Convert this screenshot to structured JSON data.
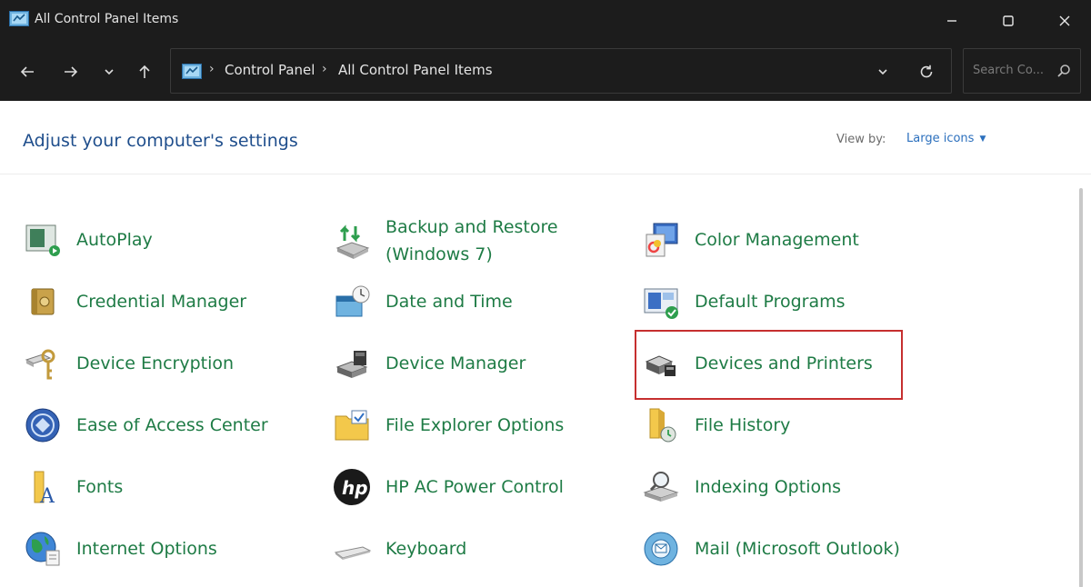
{
  "window": {
    "title": "All Control Panel Items",
    "controls": [
      "minimize",
      "maximize",
      "close"
    ]
  },
  "address": {
    "crumbs": [
      "Control Panel",
      "All Control Panel Items"
    ],
    "search_placeholder": "Search Co..."
  },
  "header": {
    "heading": "Adjust your computer's settings",
    "view_by_label": "View by:",
    "view_by_value": "Large icons"
  },
  "items": [
    {
      "label": "AutoPlay",
      "icon": "autoplay-icon"
    },
    {
      "label": "Backup and Restore (Windows 7)",
      "line1": "Backup and Restore",
      "line2": "(Windows 7)",
      "icon": "backup-restore-icon"
    },
    {
      "label": "Color Management",
      "icon": "color-management-icon"
    },
    {
      "label": "Credential Manager",
      "icon": "credential-manager-icon"
    },
    {
      "label": "Date and Time",
      "icon": "date-time-icon"
    },
    {
      "label": "Default Programs",
      "icon": "default-programs-icon"
    },
    {
      "label": "Device Encryption",
      "icon": "device-encryption-icon"
    },
    {
      "label": "Device Manager",
      "icon": "device-manager-icon"
    },
    {
      "label": "Devices and Printers",
      "icon": "devices-printers-icon",
      "highlighted": true
    },
    {
      "label": "Ease of Access Center",
      "icon": "ease-of-access-icon"
    },
    {
      "label": "File Explorer Options",
      "icon": "file-explorer-options-icon"
    },
    {
      "label": "File History",
      "icon": "file-history-icon"
    },
    {
      "label": "Fonts",
      "icon": "fonts-icon"
    },
    {
      "label": "HP AC Power Control",
      "icon": "hp-logo-icon"
    },
    {
      "label": "Indexing Options",
      "icon": "indexing-options-icon"
    },
    {
      "label": "Internet Options",
      "icon": "internet-options-icon"
    },
    {
      "label": "Keyboard",
      "icon": "keyboard-icon"
    },
    {
      "label": "Mail (Microsoft Outlook)",
      "icon": "mail-icon"
    }
  ],
  "colors": {
    "titlebar_bg": "#1c1c1c",
    "heading": "#1f4e8c",
    "item_label": "#1e7b45",
    "link": "#2b6fbd",
    "highlight": "#c62f2f"
  }
}
